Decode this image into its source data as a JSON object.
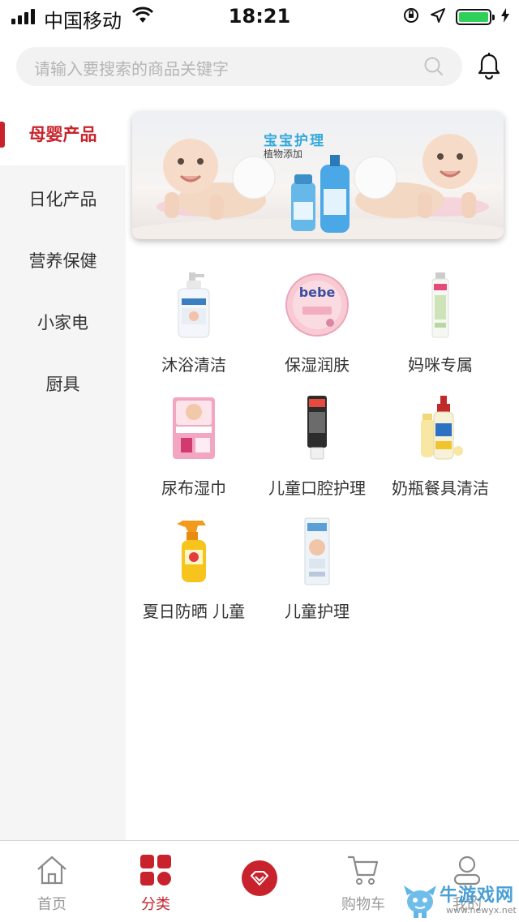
{
  "status_bar": {
    "carrier": "中国移动",
    "time": "18:21",
    "battery_color": "#2fd05a"
  },
  "search": {
    "placeholder": "请输入要搜索的商品关键字",
    "icon": "search-icon",
    "notification_icon": "bell-icon"
  },
  "sidebar": {
    "items": [
      {
        "label": "母婴产品",
        "active": true
      },
      {
        "label": "日化产品",
        "active": false
      },
      {
        "label": "营养保健",
        "active": false
      },
      {
        "label": "小家电",
        "active": false
      },
      {
        "label": "厨具",
        "active": false
      }
    ]
  },
  "banner": {
    "title": "宝宝护理",
    "subtitle": "植物添加"
  },
  "categories": [
    {
      "label": "沐浴清洁",
      "icon": "baby-wash-bottle-icon"
    },
    {
      "label": "保湿润肤",
      "icon": "cream-tin-icon"
    },
    {
      "label": "妈咪专属",
      "icon": "tube-icon"
    },
    {
      "label": "尿布湿巾",
      "icon": "diaper-pack-icon"
    },
    {
      "label": "儿童口腔护理",
      "icon": "toothpaste-icon"
    },
    {
      "label": "奶瓶餐具清洁",
      "icon": "bottle-cleaner-icon"
    },
    {
      "label": "夏日防晒 儿童",
      "icon": "sunscreen-spray-icon"
    },
    {
      "label": "儿童护理",
      "icon": "care-box-icon"
    }
  ],
  "tabbar": {
    "items": [
      {
        "label": "首页",
        "icon": "home-icon",
        "active": false
      },
      {
        "label": "分类",
        "icon": "category-grid-icon",
        "active": true
      },
      {
        "label": "",
        "icon": "diamond-center-icon",
        "active": false
      },
      {
        "label": "购物车",
        "icon": "cart-icon",
        "active": false
      },
      {
        "label": "我的",
        "icon": "user-icon",
        "active": false
      }
    ]
  },
  "watermark": {
    "title": "牛游戏网",
    "url": "www.newyx.net"
  },
  "colors": {
    "accent": "#c8232c",
    "sidebar_bg": "#f5f5f5",
    "banner_title": "#35a8dc"
  }
}
